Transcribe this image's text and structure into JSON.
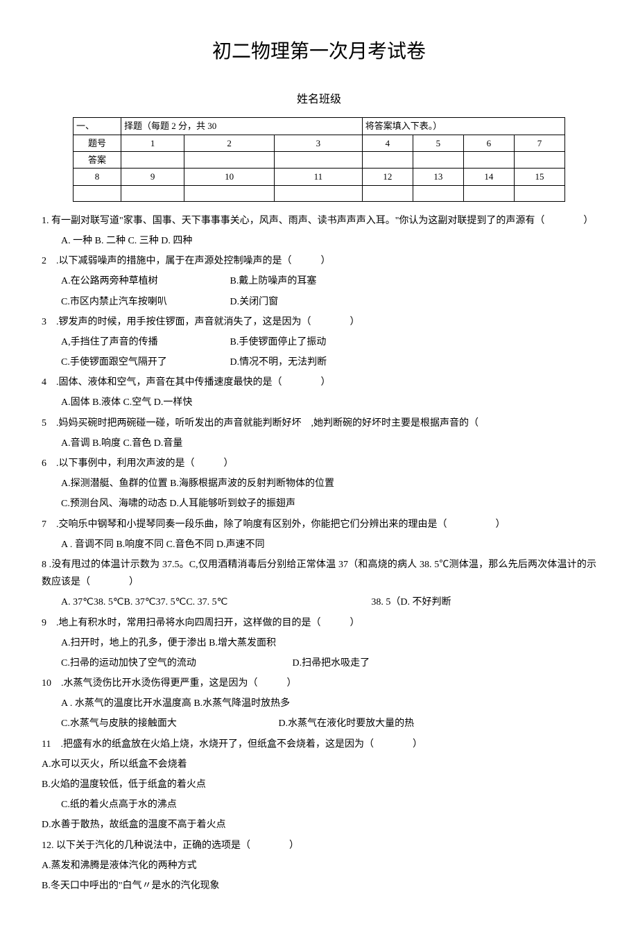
{
  "title": "初二物理第一次月考试卷",
  "subtitle": "姓名班级",
  "section_header": {
    "prefix": "一、",
    "mid": "择题（每题 2 分，共 30",
    "suffix": "将答案填入下表。）"
  },
  "table": {
    "row1": [
      "题号",
      "1",
      "2",
      "3",
      "4",
      "5",
      "6",
      "7"
    ],
    "row2": [
      "答案",
      "",
      "",
      "",
      "",
      "",
      "",
      ""
    ],
    "row3": [
      "8",
      "9",
      "10",
      "11",
      "12",
      "13",
      "14",
      "15"
    ]
  },
  "q1": {
    "text": "1. 有一副对联写道\"家事、国事、天下事事事关心，风声、雨声、读书声声声入耳。\"你认为这副对联提到了的声源有（　　　　）",
    "opts": "A. 一种 B. 二种 C. 三种 D. 四种"
  },
  "q2": {
    "text": "2　.以下减弱噪声的措施中，属于在声源处控制噪声的是（　　　）",
    "a": "A.在公路两旁种草植树",
    "b": "B.戴上防噪声的耳塞",
    "c": "C.市区内禁止汽车按喇叭",
    "d": "D.关闭门窗"
  },
  "q3": {
    "text": "3　.锣发声的时候，用手按住锣面，声音就消失了，这是因为（　　　　）",
    "a": "A,手挡住了声音的传播",
    "b": "B.手使锣面停止了振动",
    "c": "C.手使锣面跟空气隔开了",
    "d": "D.情况不明，无法判断"
  },
  "q4": {
    "text": "4　.固体、液体和空气，声音在其中传播速度最快的是（　　　　）",
    "opts": "A.固体 B.液体 C.空气 D.一样快"
  },
  "q5": {
    "text": "5　.妈妈买碗时把两碗碰一碰，听听发出的声音就能判断好坏　,她判断碗的好坏时主要是根据声音的（",
    "opts": "A.音调 B.响度 C.音色 D.音量"
  },
  "q6": {
    "text": "6　.以下事例中，利用次声波的是（　　　）",
    "ab": "A.探测潜艇、鱼群的位置 B.海豚根据声波的反射判断物体的位置",
    "cd": "C.预测台风、海啸的动态 D.人耳能够听到蚊子的振翅声"
  },
  "q7": {
    "text": "7　.交响乐中钢琴和小提琴同奏一段乐曲，除了响度有区别外，你能把它们分辨出来的理由是（　　　　　）",
    "opts": "A . 音调不同 B.响度不同 C.音色不同 D.声速不同"
  },
  "q8": {
    "text1": "8 .没有甩过的体温计示数为 37.5。C,仅用酒精消毒后分别给正常体温 37（和高烧的病人 38. 5℃测体温，那么先后两次体温计的示数应该是（　　　　）",
    "opts": "A. 37℃38. 5℃B. 37℃37. 5℃C. 37. 5℃",
    "extra": "38. 5（D. 不好判断"
  },
  "q9": {
    "text": "9　.地上有积水时，常用扫帚将水向四周扫开，这样做的目的是（　　　）",
    "ab": "A.扫开时，地上的孔多，便于渗出 B.增大蒸发面积",
    "c": "C.扫帚的运动加快了空气的流动",
    "d": "D.扫帚把水吸走了"
  },
  "q10": {
    "text": "10　.水蒸气烫伤比开水烫伤得更严重，这是因为（　　　）",
    "ab": "A . 水蒸气的温度比开水温度高 B.水蒸气降温时放热多",
    "c": "C.水蒸气与皮肤的接触面大",
    "d": "D.水蒸气在液化时要放大量的热"
  },
  "q11": {
    "text": "11　.把盛有水的纸盒放在火焰上烧，水烧开了，但纸盒不会烧着，这是因为（　　　　）",
    "a": "A.水可以灭火，所以纸盒不会烧着",
    "b": "B.火焰的温度较低，低于纸盒的着火点",
    "c": "C.纸的着火点高于水的沸点",
    "d": "D.水善于散热，故纸盒的温度不高于着火点"
  },
  "q12": {
    "text": "12. 以下关于汽化的几种说法中，正确的选项是（　　　　）",
    "a": "A.蒸发和沸腾是液体汽化的两种方式",
    "b": "B.冬天口中呼出的\"白气〃是水的汽化现象"
  }
}
